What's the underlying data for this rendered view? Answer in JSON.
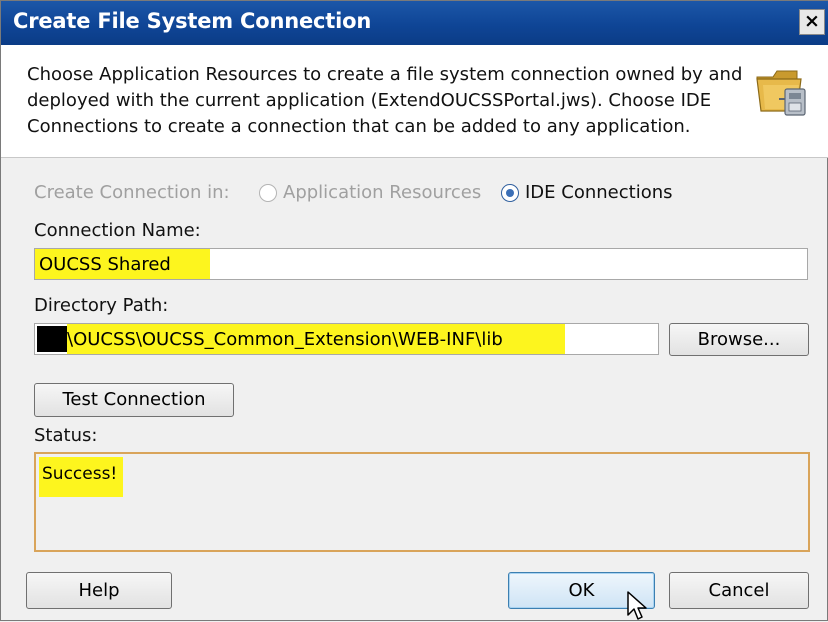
{
  "window": {
    "title": "Create File System Connection",
    "close_label": "×"
  },
  "header": {
    "description": "Choose Application Resources to create a file system connection owned by and deployed with the current application (ExtendOUCSSPortal.jws). Choose IDE Connections to create a connection that can be added to any application.",
    "icon": "folder-connection-icon"
  },
  "create_in": {
    "label": "Create Connection in:",
    "options": [
      {
        "label": "Application Resources",
        "selected": false,
        "enabled": false
      },
      {
        "label": "IDE Connections",
        "selected": true,
        "enabled": true
      }
    ]
  },
  "connection_name": {
    "label": "Connection Name:",
    "value": "OUCSS Shared"
  },
  "directory_path": {
    "label": "Directory Path:",
    "value": "\\OUCSS\\OUCSS_Common_Extension\\WEB-INF\\lib",
    "browse_label": "Browse..."
  },
  "test_connection_label": "Test Connection",
  "status": {
    "label": "Status:",
    "value": "Success!"
  },
  "footer": {
    "help_label": "Help",
    "ok_label": "OK",
    "cancel_label": "Cancel"
  },
  "colors": {
    "title_bar": "#0f4596",
    "highlight": "#fdf51e",
    "status_border": "#d9a45a"
  }
}
